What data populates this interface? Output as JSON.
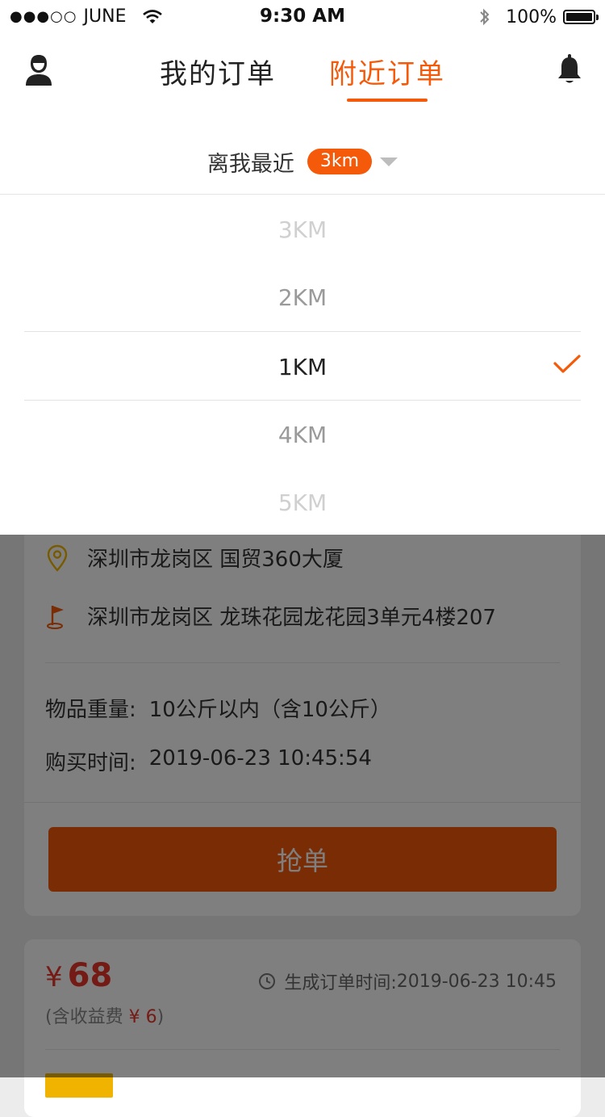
{
  "status_bar": {
    "carrier": "JUNE",
    "signal_dots": "●●●○○",
    "time": "9:30 AM",
    "battery": "100%",
    "battery_level": 1.0
  },
  "nav": {
    "tabs": [
      {
        "label": "我的订单",
        "active": false
      },
      {
        "label": "附近订单",
        "active": true
      }
    ],
    "accent_color": "#f45a0a"
  },
  "filter": {
    "label": "离我最近",
    "selected_badge": "3km"
  },
  "picker": {
    "options": [
      "3KM",
      "2KM",
      "1KM",
      "4KM",
      "5KM"
    ],
    "highlighted": "1KM"
  },
  "order_card": {
    "from_address": "深圳市龙岗区 国贸360大厦",
    "to_address": "深圳市龙岗区 龙珠花园龙花园3单元4楼207",
    "weight_label": "物品重量:",
    "weight_value": "10公斤以内（含10公斤）",
    "buy_time_label": "购买时间:",
    "buy_time_value": "2019-06-23  10:45:54",
    "grab_button": "抢单"
  },
  "order_card_2": {
    "currency": "¥",
    "price": "68",
    "fee_prefix": "(含收益费 ",
    "fee": "¥ 6",
    "fee_suffix": ")",
    "gen_time_label": "生成订单时间:",
    "gen_time_value": "2019-06-23 10:45"
  }
}
